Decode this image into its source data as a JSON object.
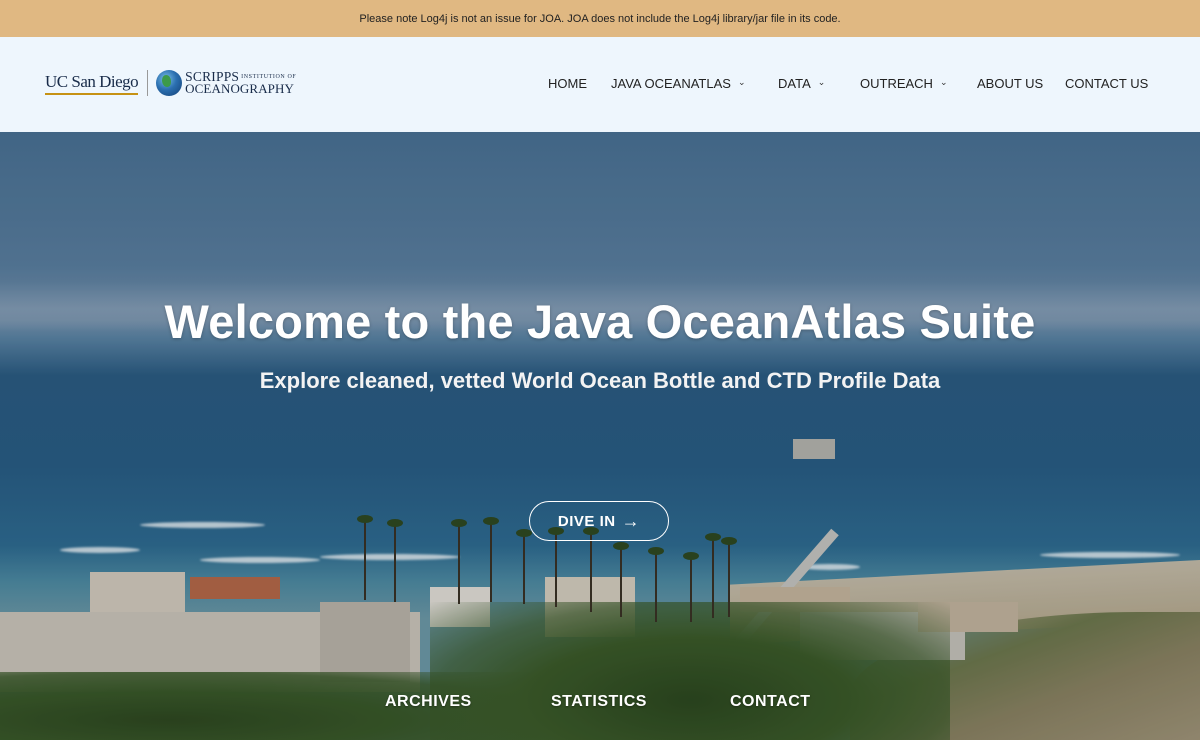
{
  "notice": {
    "text": "Please note Log4j is not an issue for JOA. JOA does not include the Log4j library/jar file in its code."
  },
  "logo": {
    "ucsd": "UC San Diego",
    "scripps_line1": "SCRIPPS",
    "scripps_small": "INSTITUTION OF",
    "scripps_line2": "OCEANOGRAPHY",
    "icon": "globe-icon"
  },
  "nav": {
    "items": [
      {
        "label": "HOME",
        "has_dropdown": false
      },
      {
        "label": "JAVA OCEANATLAS",
        "has_dropdown": true
      },
      {
        "label": "DATA",
        "has_dropdown": true
      },
      {
        "label": "OUTREACH",
        "has_dropdown": true
      },
      {
        "label": "ABOUT US",
        "has_dropdown": false
      },
      {
        "label": "CONTACT US",
        "has_dropdown": false
      }
    ],
    "chevron": "⌄"
  },
  "hero": {
    "title": "Welcome to the Java OceanAtlas Suite",
    "subtitle": "Explore cleaned, vetted World Ocean Bottle and CTD Profile Data",
    "button_label": "DIVE IN",
    "button_icon": "arrow-right-icon",
    "arrow": "→"
  },
  "bottom_links": [
    "ARCHIVES",
    "STATISTICS",
    "CONTACT"
  ],
  "colors": {
    "notice_bg": "#e0b882",
    "header_bg": "#eef6fd",
    "ucsd_navy": "#182b49",
    "ucsd_gold": "#c69214"
  }
}
